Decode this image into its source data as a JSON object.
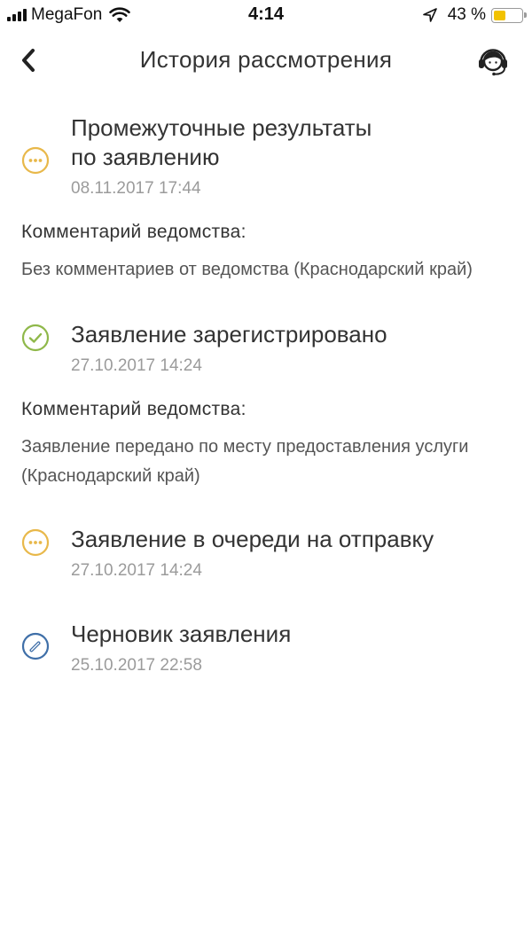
{
  "status_bar": {
    "carrier": "MegaFon",
    "time": "4:14",
    "battery_percent": "43 %",
    "battery_level": 0.43,
    "battery_color": "#f2c200"
  },
  "nav": {
    "title": "История рассмотрения",
    "back_icon": "chevron-left-icon",
    "support_icon": "headset-operator-icon"
  },
  "colors": {
    "pending": "#e8b84a",
    "success": "#8fb84a",
    "draft": "#3f6fa8"
  },
  "events": [
    {
      "status": "pending",
      "icon": "ellipsis-circle-icon",
      "title_line1": "Промежуточные результаты",
      "title_line2": "по заявлению",
      "date": "08.11.2017 17:44",
      "comment_label": "Комментарий ведомства:",
      "comment_text": "Без комментариев от ведомства (Краснодарский край)"
    },
    {
      "status": "success",
      "icon": "check-circle-icon",
      "title": "Заявление зарегистрировано",
      "date": "27.10.2017 14:24",
      "comment_label": "Комментарий ведомства:",
      "comment_text": "Заявление передано по месту предоставления услуги (Краснодарский край)"
    },
    {
      "status": "pending",
      "icon": "ellipsis-circle-icon",
      "title": "Заявление в очереди на отправку",
      "date": "27.10.2017 14:24"
    },
    {
      "status": "draft",
      "icon": "pencil-circle-icon",
      "title": "Черновик заявления",
      "date": "25.10.2017 22:58"
    }
  ]
}
